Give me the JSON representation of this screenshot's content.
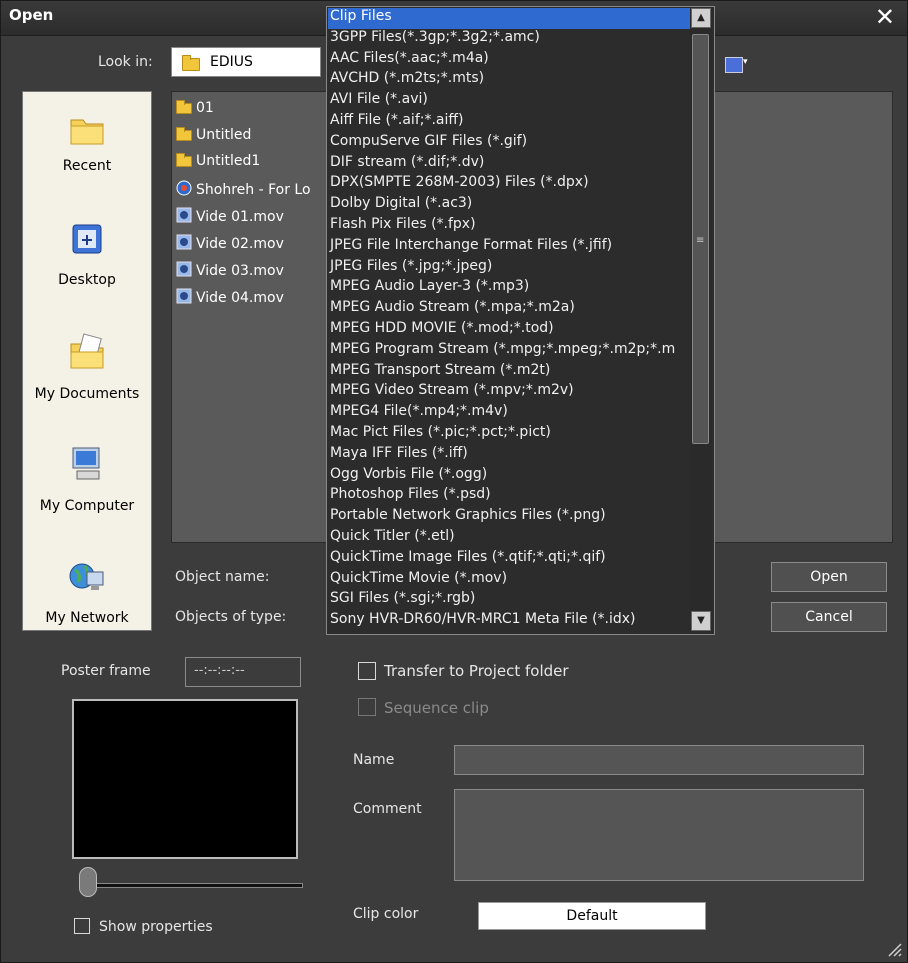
{
  "window": {
    "title": "Open"
  },
  "lookin": {
    "label": "Look in:",
    "value": "EDIUS"
  },
  "places": [
    {
      "label": "Recent",
      "icon": "recent-folder-icon"
    },
    {
      "label": "Desktop",
      "icon": "desktop-icon"
    },
    {
      "label": "My Documents",
      "icon": "my-documents-icon"
    },
    {
      "label": "My Computer",
      "icon": "my-computer-icon"
    },
    {
      "label": "My Network",
      "icon": "my-network-icon"
    }
  ],
  "files": [
    {
      "name": "01",
      "kind": "folder"
    },
    {
      "name": "Untitled",
      "kind": "folder"
    },
    {
      "name": "Untitled1",
      "kind": "folder"
    },
    {
      "name": "Shohreh - For Lo",
      "kind": "project"
    },
    {
      "name": "Vide 01.mov",
      "kind": "quicktime"
    },
    {
      "name": "Vide 02.mov",
      "kind": "quicktime"
    },
    {
      "name": "Vide 03.mov",
      "kind": "quicktime"
    },
    {
      "name": "Vide 04.mov",
      "kind": "quicktime"
    }
  ],
  "object_name_label": "Object name:",
  "objects_type_label": "Objects of type:",
  "type_options": [
    "Clip Files",
    "3GPP Files(*.3gp;*.3g2;*.amc)",
    "AAC Files(*.aac;*.m4a)",
    "AVCHD (*.m2ts;*.mts)",
    "AVI File (*.avi)",
    "Aiff File (*.aif;*.aiff)",
    "CompuServe GIF Files (*.gif)",
    "DIF stream (*.dif;*.dv)",
    "DPX(SMPTE 268M-2003) Files (*.dpx)",
    "Dolby Digital (*.ac3)",
    "Flash Pix Files (*.fpx)",
    "JPEG File Interchange Format Files (*.jfif)",
    "JPEG Files (*.jpg;*.jpeg)",
    "MPEG Audio Layer-3 (*.mp3)",
    "MPEG Audio Stream (*.mpa;*.m2a)",
    "MPEG HDD MOVIE (*.mod;*.tod)",
    "MPEG Program Stream (*.mpg;*.mpeg;*.m2p;*.m",
    "MPEG Transport Stream (*.m2t)",
    "MPEG Video Stream (*.mpv;*.m2v)",
    "MPEG4 File(*.mp4;*.m4v)",
    "Mac Pict Files (*.pic;*.pct;*.pict)",
    "Maya IFF Files (*.iff)",
    "Ogg Vorbis File (*.ogg)",
    "Photoshop Files (*.psd)",
    "Portable Network Graphics Files (*.png)",
    "Quick Titler (*.etl)",
    "QuickTime Image Files (*.qtif;*.qti;*.qif)",
    "QuickTime Movie (*.mov)",
    "SGI Files (*.sgi;*.rgb)",
    "Sony HVR-DR60/HVR-MRC1 Meta File (*.idx)"
  ],
  "selected_type": "Clip Files",
  "buttons": {
    "open": "Open",
    "cancel": "Cancel",
    "clip_color": "Default"
  },
  "poster": {
    "label": "Poster frame",
    "timecode": "--:--:--:--"
  },
  "transfer_label": "Transfer to Project folder",
  "sequence_label": "Sequence clip",
  "name_label": "Name",
  "comment_label": "Comment",
  "clip_color_label": "Clip color",
  "show_properties_label": "Show properties"
}
